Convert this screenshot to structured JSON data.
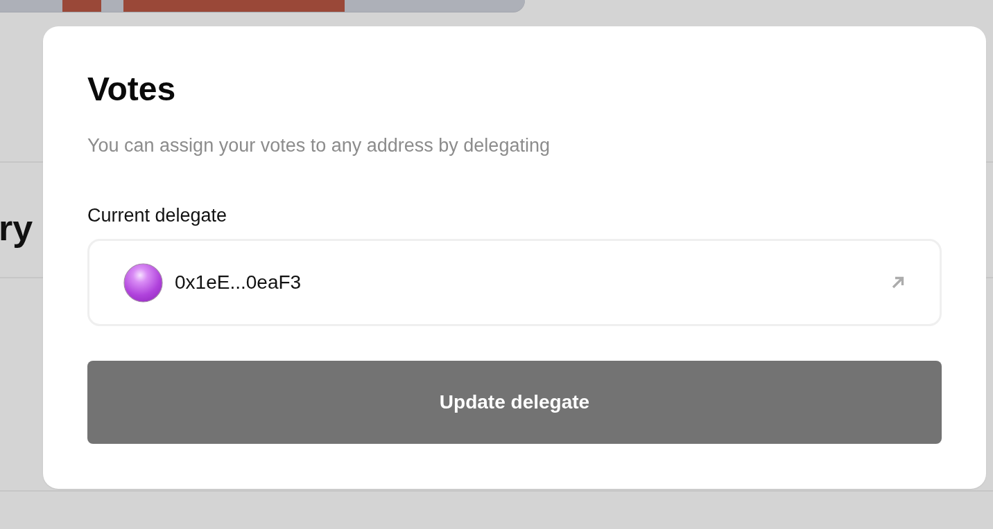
{
  "background": {
    "heading_fragment": "ry"
  },
  "dialog": {
    "title": "Votes",
    "description": "You can assign your votes to any address by delegating",
    "delegate_label": "Current delegate",
    "delegate": {
      "address": "0x1eE...0eaF3"
    },
    "button": {
      "label": "Update delegate"
    }
  }
}
